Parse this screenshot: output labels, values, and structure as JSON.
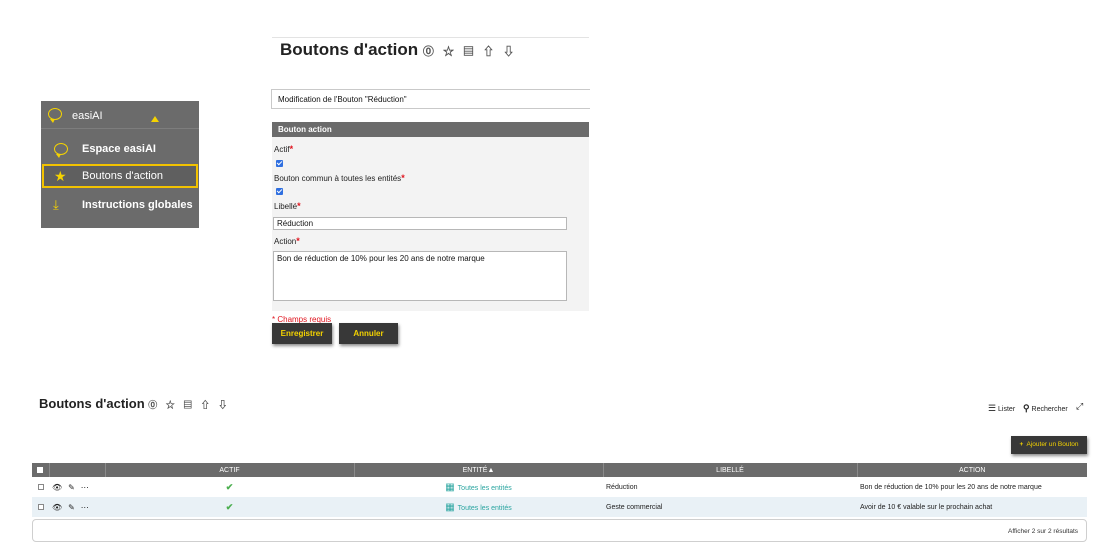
{
  "menu": {
    "title": "easiAI",
    "items": [
      {
        "label": "Espace easiAI"
      },
      {
        "label": "Boutons d'action",
        "selected": true
      },
      {
        "label": "Instructions globales"
      }
    ]
  },
  "form_page": {
    "title": "Boutons d'action",
    "title_icons": "⓪ ☆ ▤ ⇧ ⇩",
    "modification_title": "Modification de l'Bouton \"Réduction\"",
    "section_title": "Bouton action",
    "fields": {
      "actif_label": "Actif",
      "actif_checked": true,
      "commun_label": "Bouton commun à toutes les entités",
      "commun_checked": true,
      "libelle_label": "Libellé",
      "libelle_value": "Réduction",
      "action_label": "Action",
      "action_value": "Bon de réduction de 10% pour les 20 ans de notre marque"
    },
    "required_marker": "*",
    "required_note": "* Champs requis",
    "save_label": "Enregistrer",
    "cancel_label": "Annuler"
  },
  "list_page": {
    "title": "Boutons d'action",
    "title_icons": "⓪ ☆ ▤ ⇧ ⇩",
    "lister_label": "Lister",
    "rechercher_label": "Rechercher",
    "add_label": "Ajouter un Bouton",
    "columns": [
      "ACTIF",
      "ENTITÉ▲",
      "LIBELLÉ",
      "ACTION"
    ],
    "rows": [
      {
        "actif": "✔",
        "entite": "Toutes les entités",
        "libelle": "Réduction",
        "action": "Bon de réduction de 10% pour les 20 ans de notre marque"
      },
      {
        "actif": "✔",
        "entite": "Toutes les entités",
        "libelle": "Geste commercial",
        "action": "Avoir de 10 € valable sur le prochain achat"
      }
    ],
    "footer": "Afficher 2 sur 2 résultats"
  },
  "colors": {
    "accent_yellow": "#f5d300",
    "dark_button": "#383838",
    "header_gray": "#6b6b6b",
    "link_teal": "#2aa5a0",
    "required_red": "#e0141e"
  },
  "icons": [
    "chat-bubble-icon",
    "star-icon",
    "download-icon",
    "help-icon",
    "list-icon",
    "search-icon",
    "expand-icon",
    "eye-icon",
    "pencil-icon",
    "more-icon",
    "building-icon",
    "check-icon",
    "plus-icon"
  ]
}
